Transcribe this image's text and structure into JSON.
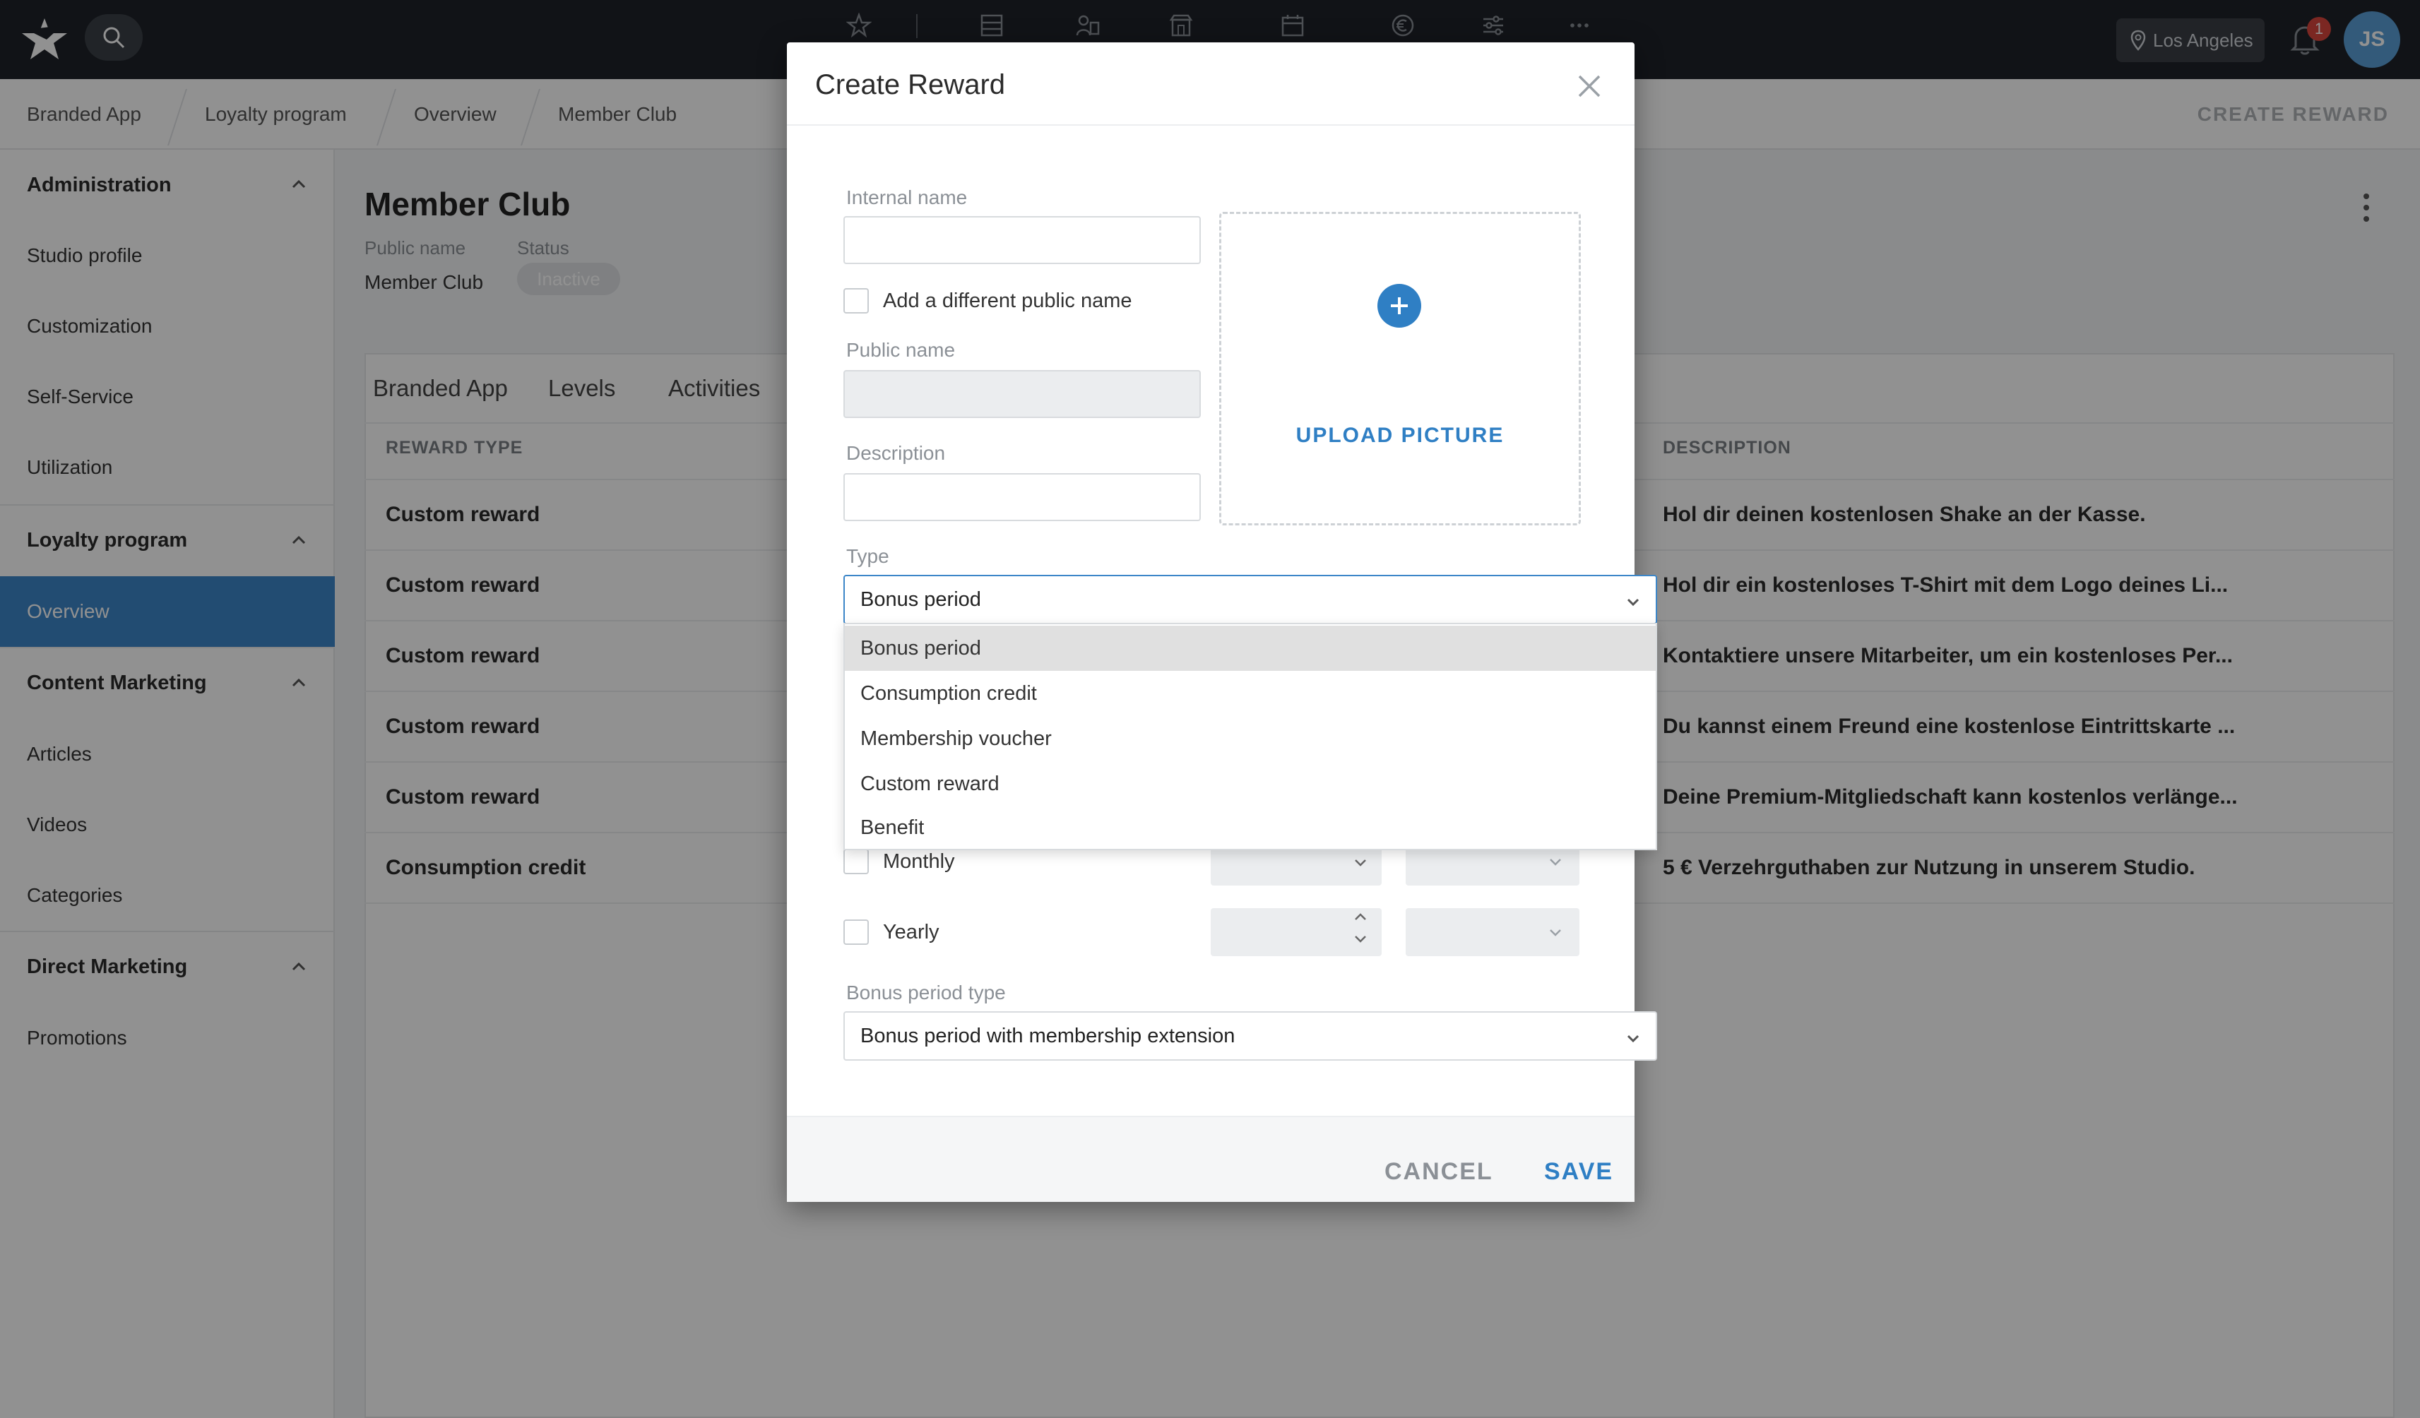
{
  "topbar": {
    "location": "Los Angeles",
    "notification_count": "1",
    "avatar_initials": "JS",
    "nav_icons": [
      "star-icon",
      "layout-icon",
      "members-icon",
      "store-icon",
      "calendar-icon",
      "euro-icon",
      "sliders-icon",
      "more-icon"
    ]
  },
  "breadcrumb": [
    "Branded App",
    "Loyalty program",
    "Overview",
    "Member Club"
  ],
  "header_action": "CREATE REWARD",
  "sidebar": {
    "administration": {
      "title": "Administration",
      "items": [
        "Studio profile",
        "Customization",
        "Self-Service",
        "Utilization"
      ]
    },
    "loyalty": {
      "title": "Loyalty program",
      "items": [
        "Overview"
      ]
    },
    "content": {
      "title": "Content Marketing",
      "items": [
        "Articles",
        "Videos",
        "Categories"
      ]
    },
    "direct": {
      "title": "Direct Marketing",
      "items": [
        "Promotions"
      ]
    }
  },
  "page": {
    "title": "Member Club",
    "public_name_label": "Public name",
    "public_name": "Member Club",
    "status_label": "Status",
    "status": "Inactive"
  },
  "tabs": [
    "Branded App",
    "Levels",
    "Activities"
  ],
  "table": {
    "headers": {
      "type": "REWARD TYPE",
      "description": "DESCRIPTION"
    },
    "rows": [
      {
        "type": "Custom reward",
        "description": "Hol dir deinen kostenlosen Shake an der Kasse."
      },
      {
        "type": "Custom reward",
        "description": "Hol dir ein kostenloses T-Shirt mit dem Logo deines Li..."
      },
      {
        "type": "Custom reward",
        "description": "Kontaktiere unsere Mitarbeiter, um ein kostenloses Per..."
      },
      {
        "type": "Custom reward",
        "description": "Du kannst einem Freund eine kostenlose Eintrittskarte ..."
      },
      {
        "type": "Custom reward",
        "description": "Deine Premium-Mitgliedschaft kann kostenlos verlänge..."
      },
      {
        "type": "Consumption credit",
        "description": "5 € Verzehrguthaben zur Nutzung in unserem Studio."
      }
    ]
  },
  "modal": {
    "title": "Create Reward",
    "internal_name_label": "Internal name",
    "internal_name_value": "",
    "different_public_name_label": "Add a different public name",
    "public_name_label": "Public name",
    "public_name_value": "",
    "description_label": "Description",
    "description_value": "",
    "upload_label": "UPLOAD PICTURE",
    "type_label": "Type",
    "type_value": "Bonus period",
    "type_options": [
      "Bonus period",
      "Consumption credit",
      "Membership voucher",
      "Custom reward",
      "Benefit"
    ],
    "monthly_label": "Monthly",
    "yearly_label": "Yearly",
    "bonus_period_type_label": "Bonus period type",
    "bonus_period_type_value": "Bonus period with membership extension",
    "cancel_label": "CANCEL",
    "save_label": "SAVE"
  },
  "colors": {
    "accent": "#2f7fc4",
    "sidebar_active": "#3c86c8",
    "topbar": "#1f2329",
    "badge": "#d9453c"
  }
}
